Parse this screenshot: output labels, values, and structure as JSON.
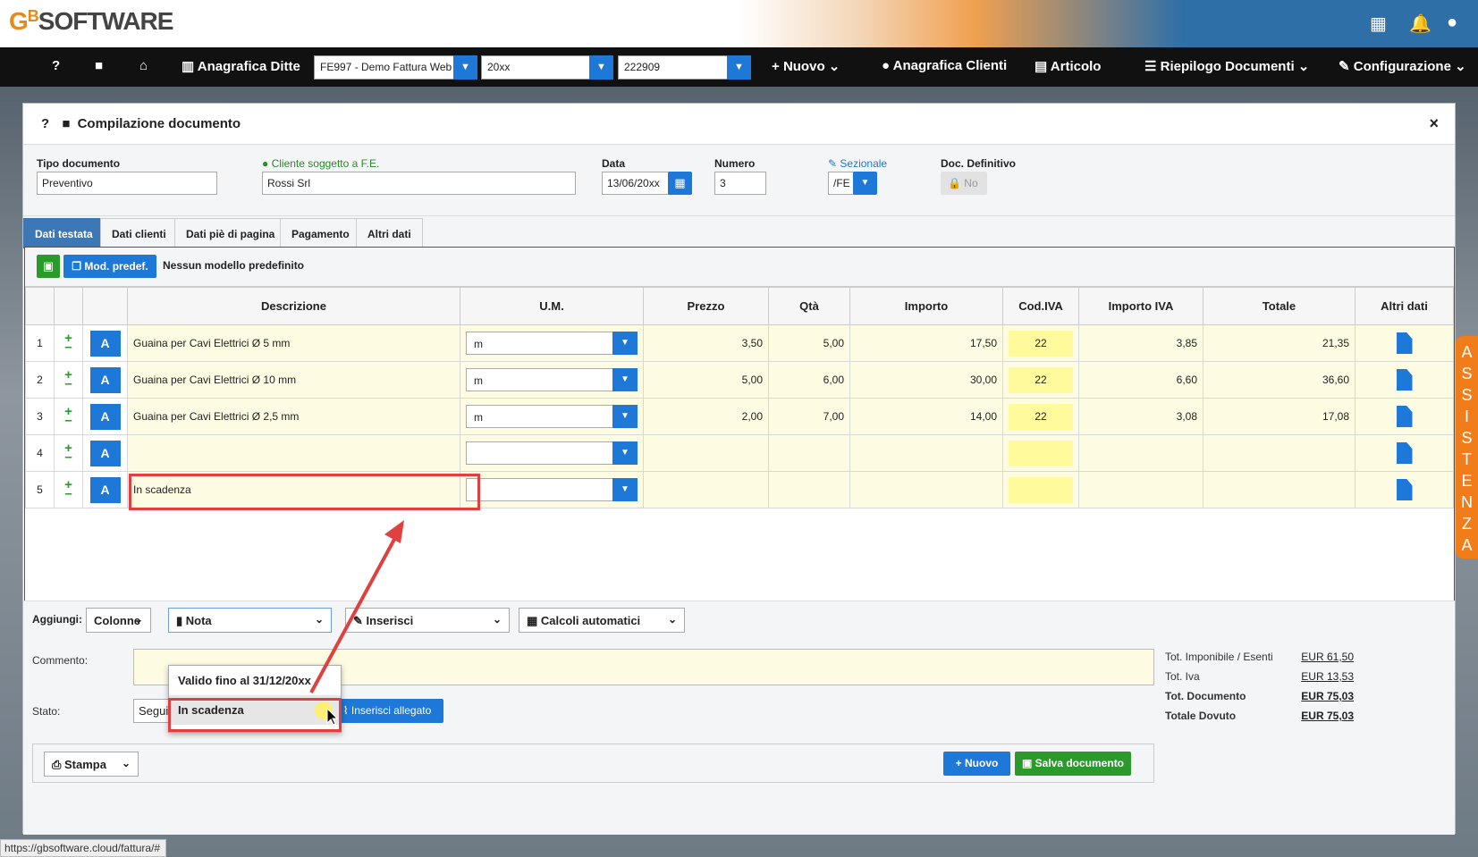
{
  "brand": {
    "logo": "GBSOFTWARE"
  },
  "topbar_icons": [
    "grid-icon",
    "bell-icon",
    "user-icon"
  ],
  "navbar": {
    "help": "?",
    "anagrafica_ditte": "Anagrafica Ditte",
    "company_select": "FE997 - Demo Fattura Web",
    "year_select": "20xx",
    "code_select": "222909",
    "nuovo": "Nuovo",
    "anagrafica_clienti": "Anagrafica Clienti",
    "articolo": "Articolo",
    "riepilogo": "Riepilogo Documenti",
    "configurazione": "Configurazione"
  },
  "modal": {
    "help": "?",
    "title": "Compilazione documento",
    "close": "×"
  },
  "fields": {
    "tipo_label": "Tipo documento",
    "tipo_value": "Preventivo",
    "cliente_label": "Cliente soggetto a F.E.",
    "cliente_value": "Rossi Srl",
    "data_label": "Data",
    "data_value": "13/06/20xx",
    "numero_label": "Numero",
    "numero_value": "3",
    "sezionale_label": "Sezionale",
    "sezionale_value": "/FE",
    "definitivo_label": "Doc. Definitivo",
    "definitivo_value": "No"
  },
  "tabs": [
    "Dati testata",
    "Dati clienti",
    "Dati piè di pagina",
    "Pagamento",
    "Altri dati"
  ],
  "grid_toolbar": {
    "mod_predef": "Mod. predef.",
    "model_text": "Nessun modello predefinito"
  },
  "columns": [
    "Descrizione",
    "U.M.",
    "Prezzo",
    "Qtà",
    "Importo",
    "Cod.IVA",
    "Importo IVA",
    "Totale",
    "Altri dati"
  ],
  "rows": [
    {
      "n": "1",
      "a": "A",
      "desc": "Guaina per Cavi Elettrici Ø 5 mm",
      "um": "m",
      "prezzo": "3,50",
      "qta": "5,00",
      "importo": "17,50",
      "iva": "22",
      "importo_iva": "3,85",
      "totale": "21,35"
    },
    {
      "n": "2",
      "a": "A",
      "desc": "Guaina per Cavi Elettrici Ø 10 mm",
      "um": "m",
      "prezzo": "5,00",
      "qta": "6,00",
      "importo": "30,00",
      "iva": "22",
      "importo_iva": "6,60",
      "totale": "36,60"
    },
    {
      "n": "3",
      "a": "A",
      "desc": "Guaina per Cavi Elettrici Ø 2,5 mm",
      "um": "m",
      "prezzo": "2,00",
      "qta": "7,00",
      "importo": "14,00",
      "iva": "22",
      "importo_iva": "3,08",
      "totale": "17,08"
    },
    {
      "n": "4",
      "a": "A",
      "desc": "",
      "um": "",
      "prezzo": "",
      "qta": "",
      "importo": "",
      "iva": "",
      "importo_iva": "",
      "totale": ""
    },
    {
      "n": "5",
      "a": "A",
      "desc": "In scadenza",
      "um": "",
      "prezzo": "",
      "qta": "",
      "importo": "",
      "iva": "",
      "importo_iva": "",
      "totale": ""
    }
  ],
  "addbar": {
    "label": "Aggiungi:",
    "colonne": "Colonne",
    "nota": "Nota",
    "inserisci": "Inserisci",
    "calcoli": "Calcoli automatici"
  },
  "dropdown": [
    "Valido fino al 31/12/20xx",
    "In scadenza"
  ],
  "bottom": {
    "commento_label": "Commento:",
    "stato_label": "Stato:",
    "stato_value": "Seguirà documento di vendita",
    "allegato": "Inserisci allegato",
    "stampa": "Stampa",
    "nuovo": "Nuovo",
    "salva": "Salva documento"
  },
  "totals": [
    {
      "label": "Tot. Imponibile / Esenti",
      "value": "EUR 61,50",
      "bold": false
    },
    {
      "label": "Tot. Iva",
      "value": "EUR 13,53",
      "bold": false
    },
    {
      "label": "Tot. Documento",
      "value": "EUR 75,03",
      "bold": true
    },
    {
      "label": "Totale Dovuto",
      "value": "EUR 75,03",
      "bold": true
    }
  ],
  "assistenza": "ASSISTENZA",
  "status_url": "https://gbsoftware.cloud/fattura/#"
}
